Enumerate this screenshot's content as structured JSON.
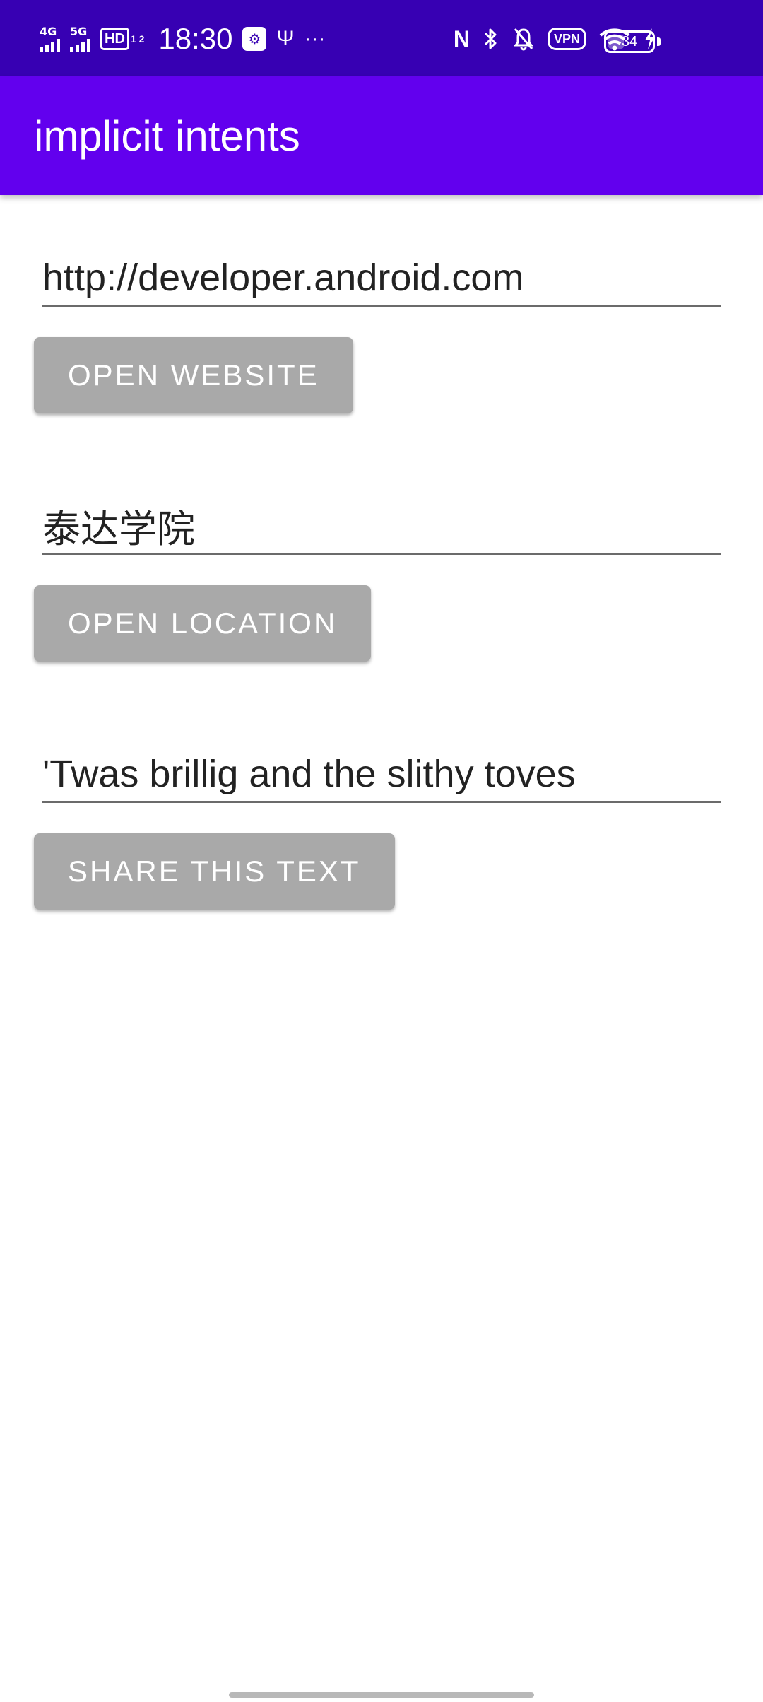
{
  "status_bar": {
    "network_1": "4G",
    "network_2": "5G",
    "hd_label": "HD",
    "hd_sub": "1 2",
    "time": "18:30",
    "more": "···",
    "nfc_icon": "N",
    "vpn": "VPN",
    "battery_level": "34"
  },
  "app_bar": {
    "title": "implicit intents"
  },
  "form": {
    "website_value": "http://developer.android.com",
    "website_button": "OPEN WEBSITE",
    "location_value": "泰达学院",
    "location_button": "OPEN LOCATION",
    "share_value": "'Twas brillig and the slithy toves",
    "share_button": "SHARE THIS TEXT"
  },
  "colors": {
    "status_bar": "#3700b3",
    "app_bar": "#6200ee",
    "button": "#a9a9a9"
  }
}
